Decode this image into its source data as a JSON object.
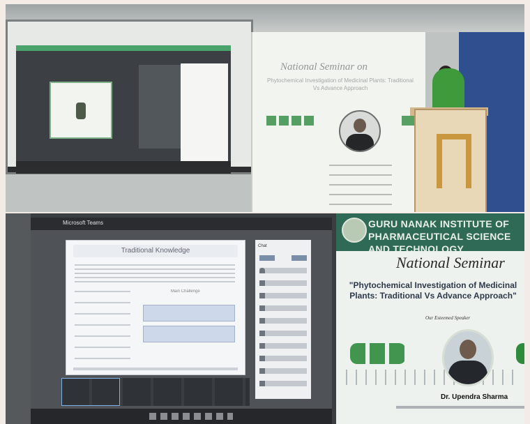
{
  "bottom_poster": {
    "institute": "GURU NANAK INSTITUTE OF PHARMACEUTICAL SCIENCE AND TECHNOLOGY",
    "seminar": "National Seminar",
    "topic": "\"Phytochemical Investigation of Medicinal Plants: Traditional Vs Advance Approach\"",
    "keynote_label": "Our Esteemed Speaker",
    "speaker_name": "Dr. Upendra Sharma"
  },
  "bottom_monitor": {
    "window_title": "Microsoft Teams",
    "slide_heading": "Traditional Knowledge",
    "slide_column_heading": "Main Challenge",
    "panel_header": "Chat"
  },
  "top_banner": {
    "title": "National Seminar on",
    "subtitle": "Phytochemical Investigation of Medicinal Plants: Traditional Vs Advance Approach"
  },
  "colors": {
    "poster_band": "#2f6a57",
    "speaker_dress": "#3e9a3a",
    "wall": "#2f4f8f"
  },
  "icons": [
    "leaf-icon",
    "molecule-hexagon-icon",
    "institute-logo-icon"
  ]
}
